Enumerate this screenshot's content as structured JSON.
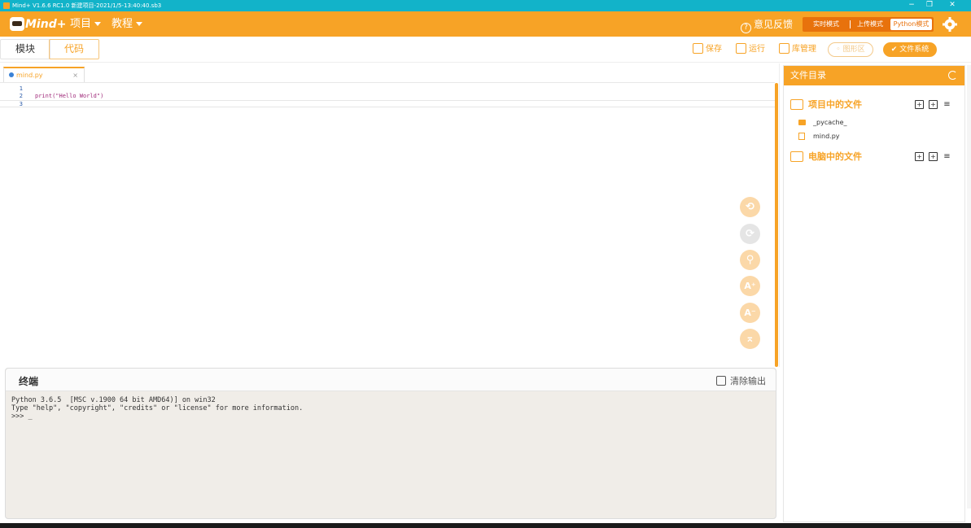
{
  "window": {
    "title": "Mind+ V1.6.6 RC1.0   新建项目-2021/1/5-13:40:40.sb3",
    "minimize": "−",
    "maximize": "❐",
    "close": "✕"
  },
  "menubar": {
    "logo_text": "Mind+",
    "project_menu": "项目",
    "tutorial_menu": "教程",
    "feedback": "意见反馈",
    "modes": {
      "realtime": "实时模式",
      "upload": "上传模式",
      "python": "Python模式"
    },
    "settings_icon": "gear-icon"
  },
  "toolbar": {
    "tab_blocks": "模块",
    "tab_code": "代码",
    "save": "保存",
    "run": "运行",
    "library": "库管理",
    "graphics": "图形区",
    "filesystem": "文件系统"
  },
  "editor": {
    "file_tab": "mind.py",
    "file_tab_close": "×",
    "lines": [
      {
        "num": "1",
        "text": ""
      },
      {
        "num": "2",
        "text": "print(\"Hello World\")"
      },
      {
        "num": "3",
        "text": ""
      }
    ],
    "float_buttons": [
      {
        "name": "undo-icon",
        "glyph": "⟲"
      },
      {
        "name": "redo-icon",
        "glyph": "⟳"
      },
      {
        "name": "search-icon",
        "glyph": "⚲"
      },
      {
        "name": "font-increase-icon",
        "glyph": "A⁺"
      },
      {
        "name": "font-decrease-icon",
        "glyph": "A⁻"
      },
      {
        "name": "scroll-top-icon",
        "glyph": "⌅"
      }
    ]
  },
  "terminal": {
    "title": "终端",
    "clear": "清除输出",
    "output": "Python 3.6.5  [MSC v.1900 64 bit AMD64)] on win32\nType \"help\", \"copyright\", \"credits\" or \"license\" for more information.\n>>> _"
  },
  "file_panel": {
    "title": "文件目录",
    "project_files": "项目中的文件",
    "project_items": [
      {
        "type": "folder",
        "name": "_pycache_"
      },
      {
        "type": "file",
        "name": "mind.py"
      }
    ],
    "computer_files": "电脑中的文件"
  },
  "colors": {
    "accent": "#f7a326",
    "titlebar": "#12b3c9",
    "mode_bg": "#e8720c",
    "terminal_bg": "#f0ede8"
  }
}
